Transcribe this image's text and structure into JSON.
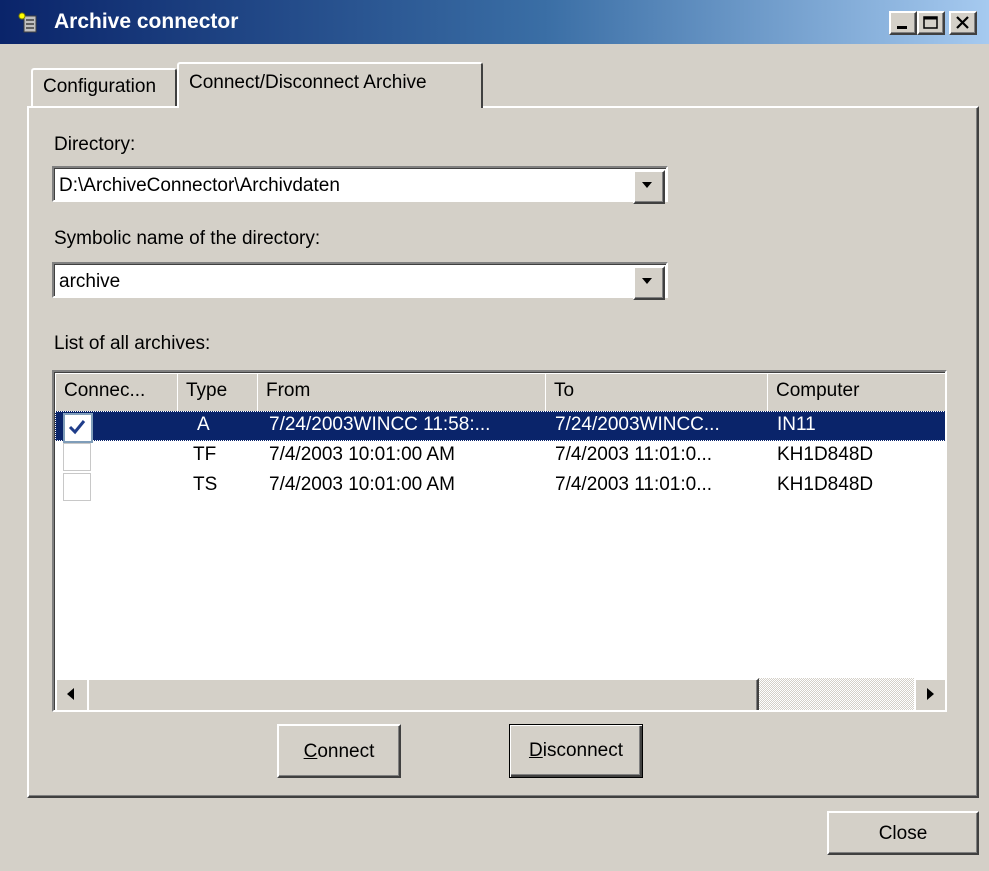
{
  "window": {
    "title": "Archive connector",
    "icon": "archive-connector-icon",
    "caption_buttons": [
      "minimize-icon",
      "maximize-icon",
      "close-icon"
    ]
  },
  "tabs": [
    {
      "label": "Configuration",
      "active": false
    },
    {
      "label": "Connect/Disconnect Archive",
      "active": true
    }
  ],
  "directory": {
    "label": "Directory:",
    "value": "D:\\ArchiveConnector\\Archivdaten"
  },
  "symbolic_name": {
    "label": "Symbolic name of the directory:",
    "value": "archive"
  },
  "archives": {
    "label": "List of all archives:",
    "columns": [
      "Connec...",
      "Type",
      "From",
      "To",
      "Computer"
    ],
    "rows": [
      {
        "connected": true,
        "type": "A",
        "from": "7/24/2003WINCC 11:58:...",
        "to": "7/24/2003WINCC...",
        "computer": "IN11",
        "selected": true
      },
      {
        "connected": false,
        "type": "TF",
        "from": "7/4/2003 10:01:00 AM",
        "to": "7/4/2003 11:01:0...",
        "computer": "KH1D848D",
        "selected": false
      },
      {
        "connected": false,
        "type": "TS",
        "from": "7/4/2003 10:01:00 AM",
        "to": "7/4/2003 11:01:0...",
        "computer": "KH1D848D",
        "selected": false
      }
    ]
  },
  "buttons": {
    "connect": {
      "mnemonic": "C",
      "rest": "onnect"
    },
    "disconnect": {
      "mnemonic": "D",
      "rest": "isconnect"
    },
    "close": "Close"
  },
  "colors": {
    "selection": "#0a246a",
    "face": "#d4d0c8"
  }
}
